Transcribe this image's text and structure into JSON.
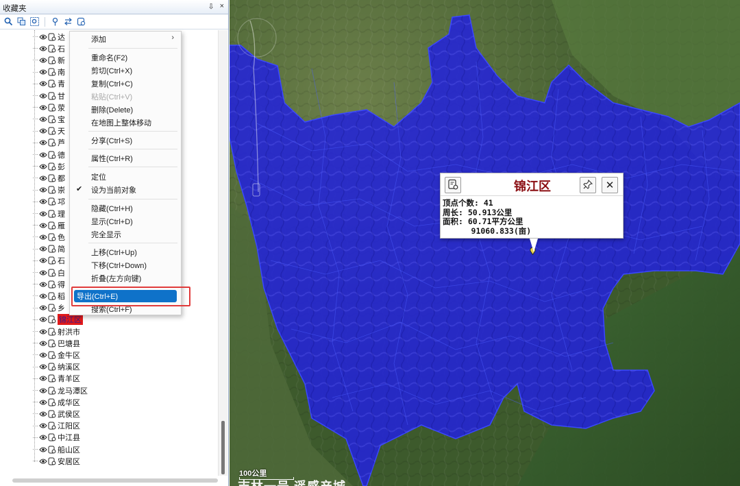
{
  "panel": {
    "title": "收藏夹",
    "pin_glyph": "⇩",
    "close_glyph": "×",
    "toolbar_icons": [
      "search-icon",
      "copy-icon",
      "zoom-select-icon",
      "pin-icon",
      "swap-icon",
      "layer-icon"
    ]
  },
  "tree": {
    "items": [
      {
        "label": "达",
        "highlight": false
      },
      {
        "label": "石",
        "highlight": false
      },
      {
        "label": "新",
        "highlight": false
      },
      {
        "label": "南",
        "highlight": false
      },
      {
        "label": "青",
        "highlight": false
      },
      {
        "label": "甘",
        "highlight": false
      },
      {
        "label": "荥",
        "highlight": false
      },
      {
        "label": "宝",
        "highlight": false
      },
      {
        "label": "天",
        "highlight": false
      },
      {
        "label": "芦",
        "highlight": false
      },
      {
        "label": "德",
        "highlight": false
      },
      {
        "label": "彭",
        "highlight": false
      },
      {
        "label": "都",
        "highlight": false
      },
      {
        "label": "崇",
        "highlight": false
      },
      {
        "label": "邛",
        "highlight": false
      },
      {
        "label": "理",
        "highlight": false
      },
      {
        "label": "雁",
        "highlight": false
      },
      {
        "label": "色",
        "highlight": false
      },
      {
        "label": "简",
        "highlight": false
      },
      {
        "label": "石",
        "highlight": false
      },
      {
        "label": "白",
        "highlight": false
      },
      {
        "label": "得",
        "highlight": false
      },
      {
        "label": "稻",
        "highlight": false
      },
      {
        "label": "乡",
        "highlight": false
      },
      {
        "label": "锦江区",
        "highlight": true
      },
      {
        "label": "射洪市",
        "highlight": false
      },
      {
        "label": "巴塘县",
        "highlight": false
      },
      {
        "label": "金牛区",
        "highlight": false
      },
      {
        "label": "纳溪区",
        "highlight": false
      },
      {
        "label": "青羊区",
        "highlight": false
      },
      {
        "label": "龙马潭区",
        "highlight": false
      },
      {
        "label": "成华区",
        "highlight": false
      },
      {
        "label": "武侯区",
        "highlight": false
      },
      {
        "label": "江阳区",
        "highlight": false
      },
      {
        "label": "中江县",
        "highlight": false
      },
      {
        "label": "船山区",
        "highlight": false
      },
      {
        "label": "安居区",
        "highlight": false
      }
    ]
  },
  "context_menu": {
    "items": [
      {
        "label": "添加",
        "has_submenu": true,
        "arrow": "›"
      },
      {
        "label": "重命名(F2)"
      },
      {
        "label": "剪切(Ctrl+X)"
      },
      {
        "label": "复制(Ctrl+C)"
      },
      {
        "label": "粘贴(Ctrl+V)",
        "disabled": true
      },
      {
        "label": "删除(Delete)"
      },
      {
        "label": "在地图上整体移动"
      },
      {
        "label": "分享(Ctrl+S)"
      },
      {
        "label": "属性(Ctrl+R)"
      },
      {
        "label": "定位"
      },
      {
        "label": "设为当前对象",
        "checked": true,
        "check_glyph": "✔"
      },
      {
        "label": "隐藏(Ctrl+H)"
      },
      {
        "label": "显示(Ctrl+D)"
      },
      {
        "label": "完全显示"
      },
      {
        "label": "上移(Ctrl+Up)"
      },
      {
        "label": "下移(Ctrl+Down)"
      },
      {
        "label": "折叠(左方向键)"
      },
      {
        "label": "导出(Ctrl+E)",
        "active": true
      },
      {
        "label": "搜索(Ctrl+F)"
      }
    ]
  },
  "popup": {
    "title": "锦江区",
    "lines": [
      "顶点个数: 41",
      "周长: 50.913公里",
      "面积: 60.71平方公里",
      "      91060.833(亩)"
    ],
    "close_glyph": "✕"
  },
  "map": {
    "scale_label": "100公里",
    "watermark": "吉林一号 遥感产城",
    "colors": {
      "region_fill": "#2323d8",
      "region_border": "#3a48ff",
      "terrain_green": "#4a6b36",
      "terrain_dark": "#2f4a24"
    }
  }
}
